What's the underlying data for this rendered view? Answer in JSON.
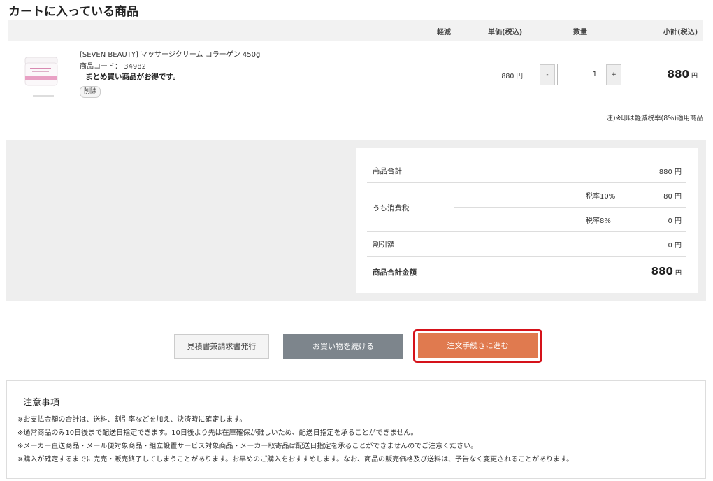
{
  "page_title": "カートに入っている商品",
  "table_headers": {
    "reduced": "軽減",
    "unit_price": "単価(税込)",
    "quantity": "数量",
    "subtotal": "小計(税込)"
  },
  "item": {
    "name": "[SEVEN BEAUTY] マッサージクリーム コラーゲン 450g",
    "code": "商品コード： 34982",
    "note": "まとめ買い商品がお得です。",
    "delete_label": "削除",
    "unit_price": "880 円",
    "qty_minus": "-",
    "quantity": "1",
    "qty_plus": "+",
    "subtotal": "880",
    "subtotal_unit": "円"
  },
  "tax_notice": "注)※印は軽減税率(8%)適用商品",
  "summary": {
    "goods_total_label": "商品合計",
    "goods_total_value": "880 円",
    "tax_label": "うち消費税",
    "tax10_label": "税率10%",
    "tax10_value": "80 円",
    "tax8_label": "税率8%",
    "tax8_value": "0 円",
    "discount_label": "割引額",
    "discount_value": "0 円",
    "grand_label": "商品合計金額",
    "grand_value": "880",
    "grand_unit": "円"
  },
  "buttons": {
    "estimate": "見積書兼請求書発行",
    "continue": "お買い物を続ける",
    "proceed": "注文手続きに進む"
  },
  "cautions": {
    "title": "注意事項",
    "lines": [
      "※お支払金額の合計は、送料、割引率などを加え、決済時に確定します。",
      "※通常商品のみ10日後まで配送日指定できます。10日後より先は在庫確保が難しいため、配送日指定を承ることができません。",
      "※メーカー直送商品・メール便対象商品・組立設置サービス対象商品・メーカー取寄品は配送日指定を承ることができませんのでご注意ください。",
      "※購入が確定するまでに完売・販売終了してしまうことがあります。お早めのご購入をおすすめします。なお、商品の販売価格及び送料は、予告なく変更されることがあります。"
    ]
  },
  "colors": {
    "accent": "#e07a4f",
    "highlight": "#d5121a",
    "secondary_button": "#7d858c",
    "panel": "#eeeeee"
  },
  "icons": {
    "product_thumbnail": "cream-jar-image"
  }
}
